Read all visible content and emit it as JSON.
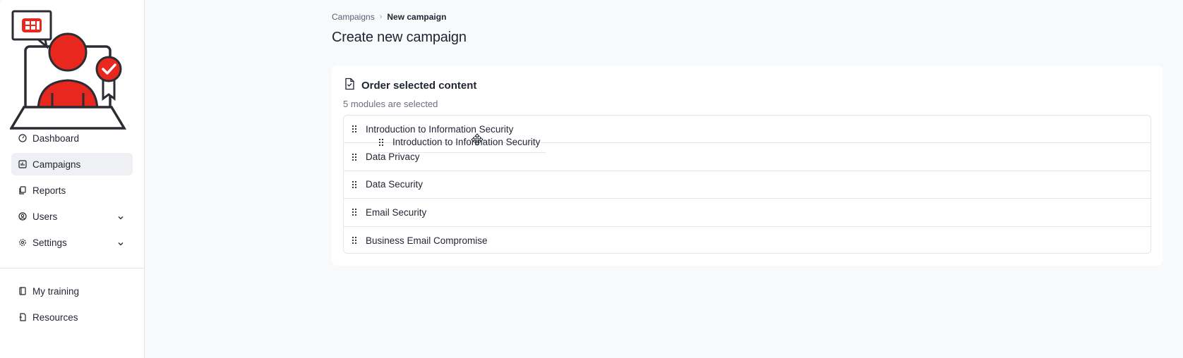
{
  "sidebar": {
    "nav": [
      {
        "label": "Dashboard",
        "icon": "gauge-icon"
      },
      {
        "label": "Campaigns",
        "icon": "chart-icon",
        "active": true
      },
      {
        "label": "Reports",
        "icon": "copy-icon"
      },
      {
        "label": "Users",
        "icon": "user-circle-icon",
        "expandable": true
      },
      {
        "label": "Settings",
        "icon": "gear-icon",
        "expandable": true
      }
    ],
    "secondary": [
      {
        "label": "My training",
        "icon": "book-icon"
      },
      {
        "label": "Resources",
        "icon": "file-icon"
      }
    ]
  },
  "breadcrumb": {
    "parent": "Campaigns",
    "current": "New campaign"
  },
  "page": {
    "title": "Create new campaign"
  },
  "card": {
    "title": "Order selected content",
    "subtitle": "5 modules are selected",
    "modules": [
      "Introduction to Information Security",
      "Data Privacy",
      "Data Security",
      "Email Security",
      "Business Email Compromise"
    ],
    "dragging_label": "Introduction to Information Security"
  },
  "colors": {
    "brand_red": "#e8271e",
    "dark": "#2b2d33",
    "active_bg": "#eef0f3"
  }
}
